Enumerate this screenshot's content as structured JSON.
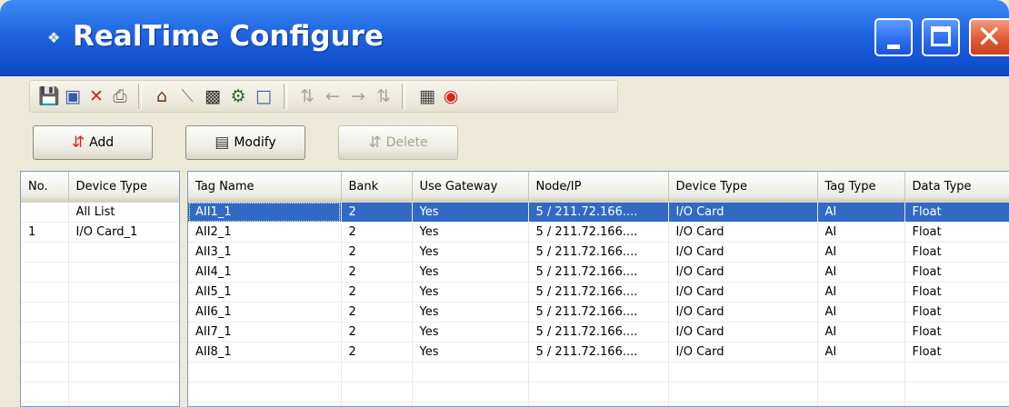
{
  "window": {
    "title": "RealTime Configure",
    "accent": "#1452d0",
    "close_color": "#e05a35"
  },
  "toolbar": {
    "icons": [
      "save-icon",
      "open-icon",
      "delete-x-icon",
      "print-icon",
      "home-icon",
      "line-icon",
      "document-icon",
      "settings-tool-icon",
      "export-icon",
      "align-icon",
      "arrow-left-icon",
      "arrow-right-icon",
      "align-right-icon",
      "network-icon",
      "stop-icon"
    ]
  },
  "actions": {
    "add_label": "Add",
    "modify_label": "Modify",
    "delete_label": "Delete"
  },
  "left_table": {
    "columns": [
      "No.",
      "Device Type"
    ],
    "rows": [
      [
        "",
        "All List"
      ],
      [
        "1",
        "I/O Card_1"
      ]
    ]
  },
  "tag_table": {
    "columns": [
      "Tag Name",
      "Bank",
      "Use Gateway",
      "Node/IP",
      "Device Type",
      "Tag Type",
      "Data Type"
    ],
    "selected_row": 0,
    "selection_color": "#316ac5",
    "rows": [
      [
        "AII1_1",
        "2",
        "Yes",
        "5 / 211.72.166....",
        "I/O Card",
        "AI",
        "Float"
      ],
      [
        "AII2_1",
        "2",
        "Yes",
        "5 / 211.72.166....",
        "I/O Card",
        "AI",
        "Float"
      ],
      [
        "AII3_1",
        "2",
        "Yes",
        "5 / 211.72.166....",
        "I/O Card",
        "AI",
        "Float"
      ],
      [
        "AII4_1",
        "2",
        "Yes",
        "5 / 211.72.166....",
        "I/O Card",
        "AI",
        "Float"
      ],
      [
        "AII5_1",
        "2",
        "Yes",
        "5 / 211.72.166....",
        "I/O Card",
        "AI",
        "Float"
      ],
      [
        "AII6_1",
        "2",
        "Yes",
        "5 / 211.72.166....",
        "I/O Card",
        "AI",
        "Float"
      ],
      [
        "AII7_1",
        "2",
        "Yes",
        "5 / 211.72.166....",
        "I/O Card",
        "AI",
        "Float"
      ],
      [
        "AII8_1",
        "2",
        "Yes",
        "5 / 211.72.166....",
        "I/O Card",
        "AI",
        "Float"
      ]
    ]
  }
}
